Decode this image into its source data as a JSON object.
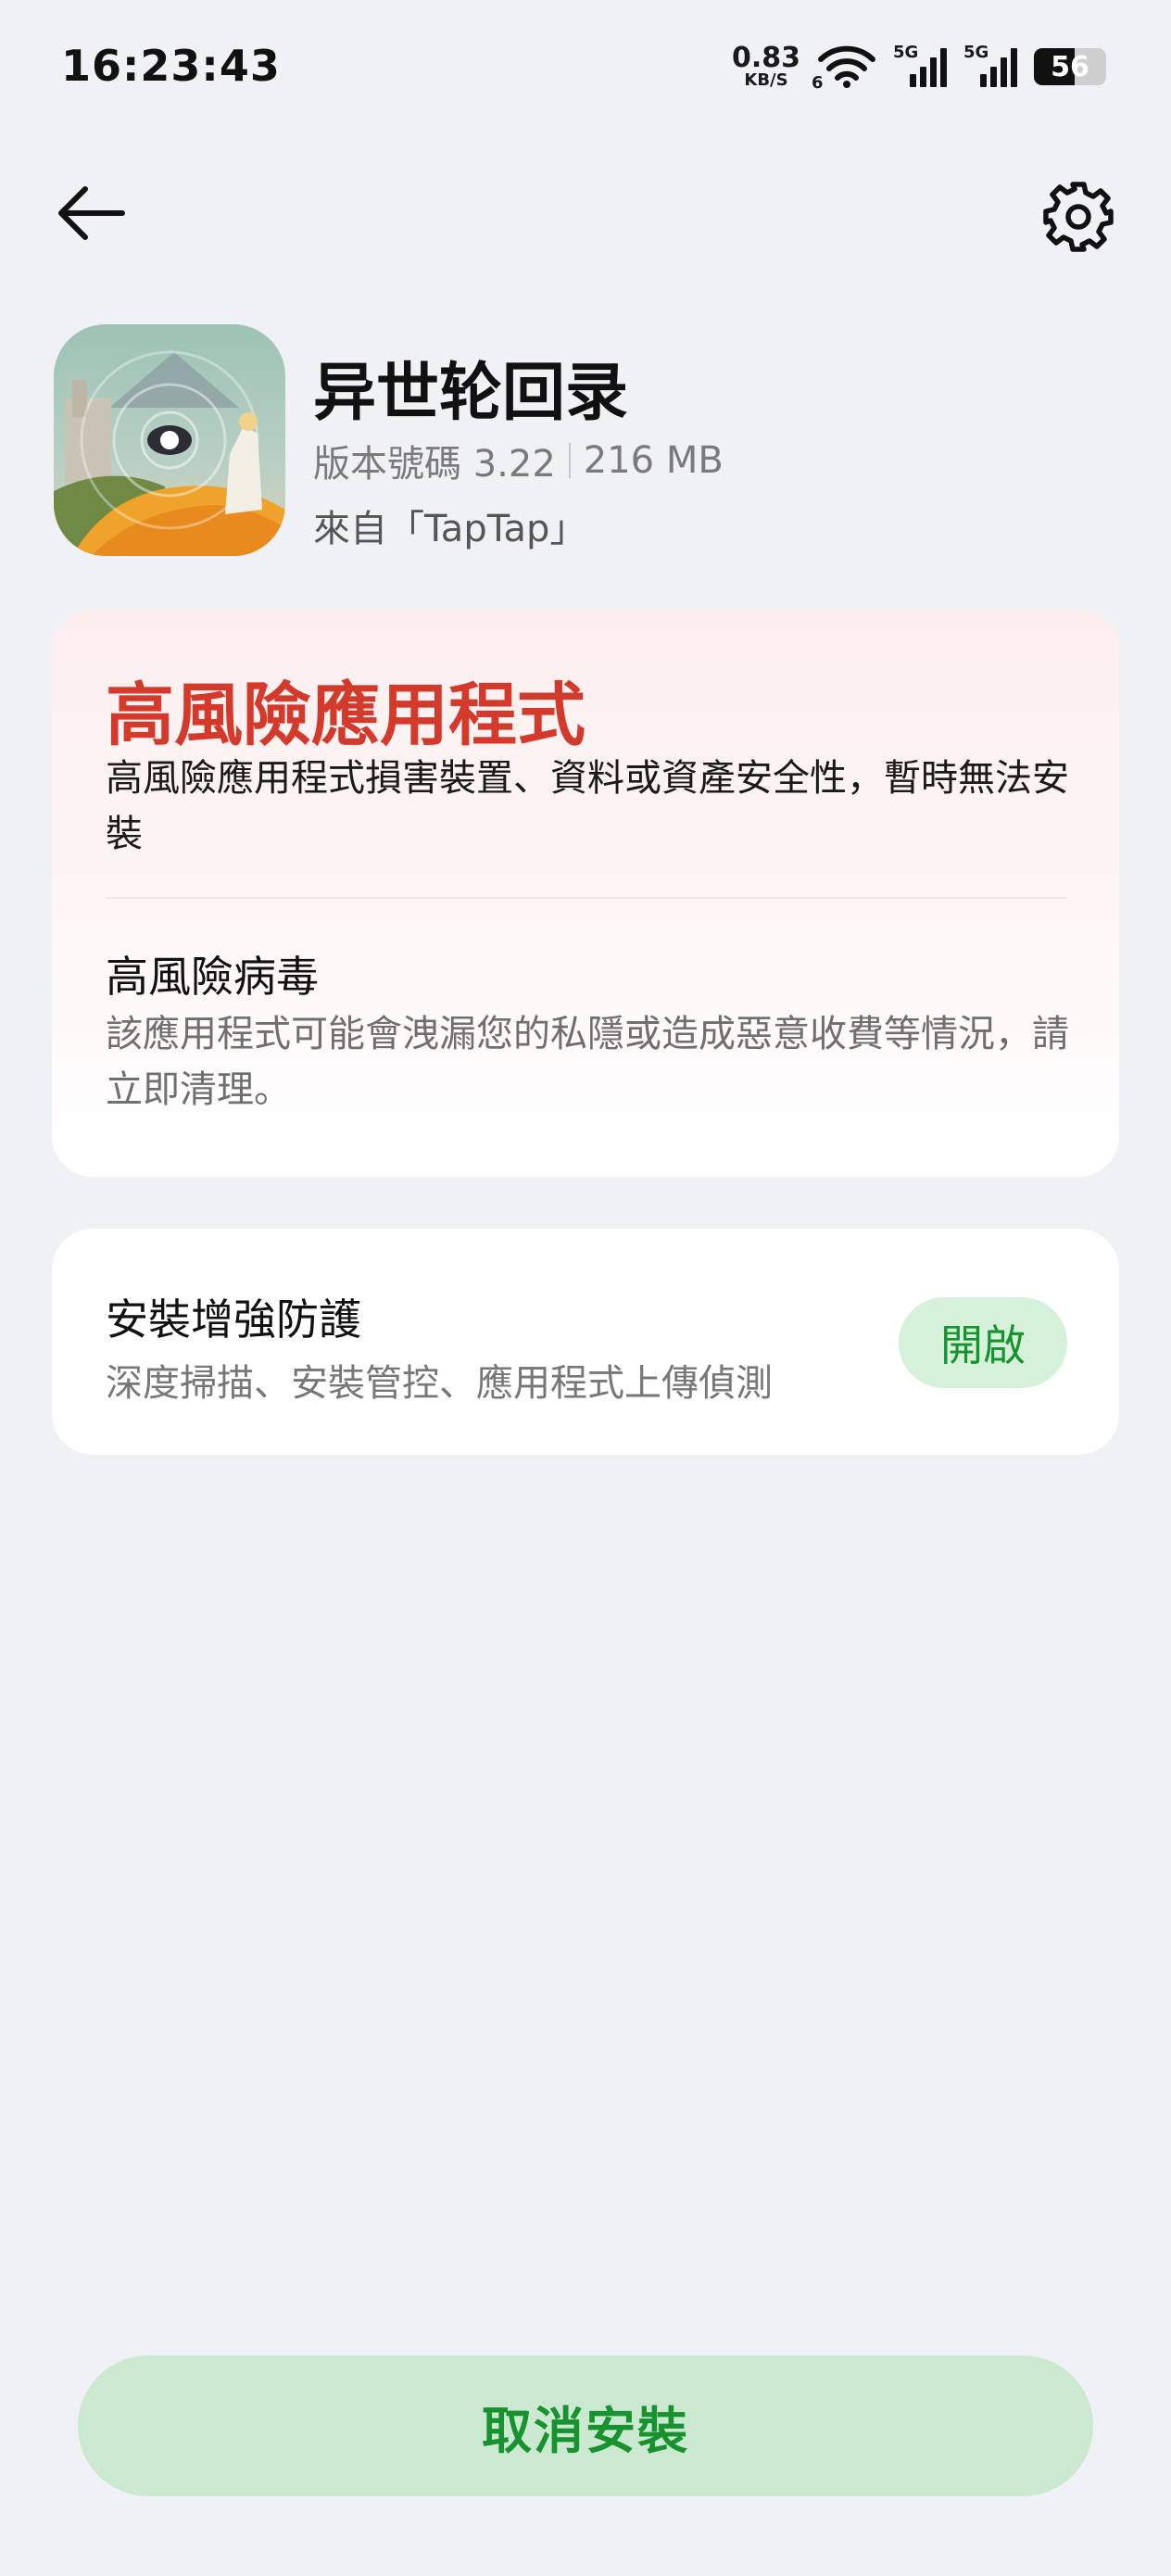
{
  "status_bar": {
    "time": "16:23:43",
    "net_speed_value": "0.83",
    "net_speed_unit": "KB/S",
    "wifi_tag": "6",
    "sim1_tag": "5G",
    "sim2_tag": "5G",
    "battery_percent": 56,
    "battery_label": "56"
  },
  "nav": {
    "back_icon": "arrow-left-icon",
    "settings_icon": "gear-icon"
  },
  "app": {
    "name": "异世轮回录",
    "version": "版本號碼 3.22",
    "size": "216 MB",
    "source": "來自「TapTap」"
  },
  "risk": {
    "title": "高風險應用程式",
    "description": "高風險應用程式損害裝置、資料或資產安全性，暫時無法安裝",
    "virus_title": "高風險病毒",
    "virus_description": "該應用程式可能會洩漏您的私隱或造成惡意收費等情況，請立即清理。",
    "accent_color": "#d33a2c"
  },
  "protection": {
    "title": "安裝增強防護",
    "description": "深度掃描、安裝管控、應用程式上傳偵測",
    "button_label": "開啟",
    "accent_color": "#17922e"
  },
  "footer": {
    "cancel_label": "取消安裝"
  }
}
